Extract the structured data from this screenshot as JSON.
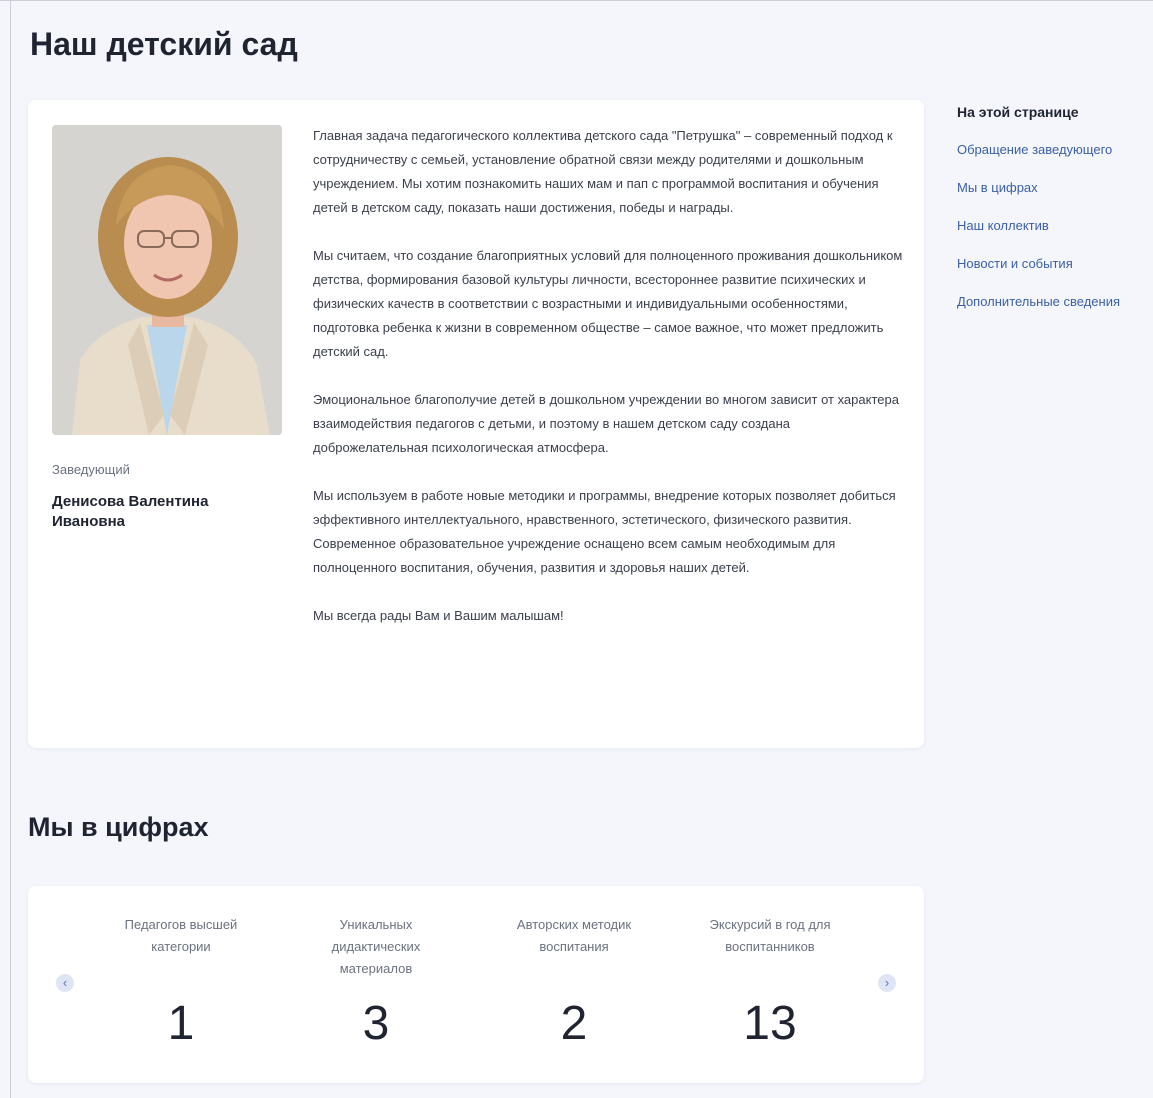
{
  "page": {
    "title": "Наш детский сад"
  },
  "director": {
    "role": "Заведующий",
    "name": "Денисова Валентина Ивановна"
  },
  "intro": {
    "paragraphs": [
      "Главная задача педагогического коллектива детского сада \"Петрушка\" – современный подход к сотрудничеству с семьей, установление обратной связи между родителями и дошкольным учреждением. Мы хотим познакомить наших мам и пап с программой воспитания и обучения детей в детском саду, показать наши достижения, победы и награды.",
      "Мы считаем, что создание благоприятных условий для полноценного проживания дошкольником детства, формирования базовой культуры личности, всестороннее развитие психических и физических качеств в соответствии с возрастными и индивидуальными особенностями, подготовка ребенка к жизни в современном обществе – самое важное, что может предложить детский сад.",
      "Эмоциональное благополучие детей в дошкольном учреждении во многом зависит от характера взаимодействия педагогов с детьми, и поэтому в нашем детском саду создана доброжелательная психологическая атмосфера.",
      "Мы используем в работе новые методики и программы, внедрение которых позволяет добиться эффективного интеллектуального, нравственного, эстетического, физического развития. Современное образовательное учреждение оснащено всем самым необходимым для полноценного воспитания, обучения, развития и здоровья наших детей.",
      "Мы всегда рады Вам и Вашим малышам!"
    ]
  },
  "toc": {
    "title": "На этой странице",
    "items": [
      "Обращение заведующего",
      "Мы в цифрах",
      "Наш коллектив",
      "Новости и события",
      "Дополнительные сведения"
    ]
  },
  "stats": {
    "title": "Мы в цифрах",
    "prev_icon": "‹",
    "next_icon": "›",
    "items": [
      {
        "label": "Педагогов высшей категории",
        "value": "1"
      },
      {
        "label": "Уникальных дидактических материалов",
        "value": "3"
      },
      {
        "label": "Авторских методик воспитания",
        "value": "2"
      },
      {
        "label": "Экскурсий в год для воспитанников",
        "value": "13"
      }
    ]
  },
  "colors": {
    "background": "#f4f6fb",
    "card": "#ffffff",
    "link": "#3b5fa8",
    "text": "#1f2430",
    "muted": "#6b7280"
  }
}
